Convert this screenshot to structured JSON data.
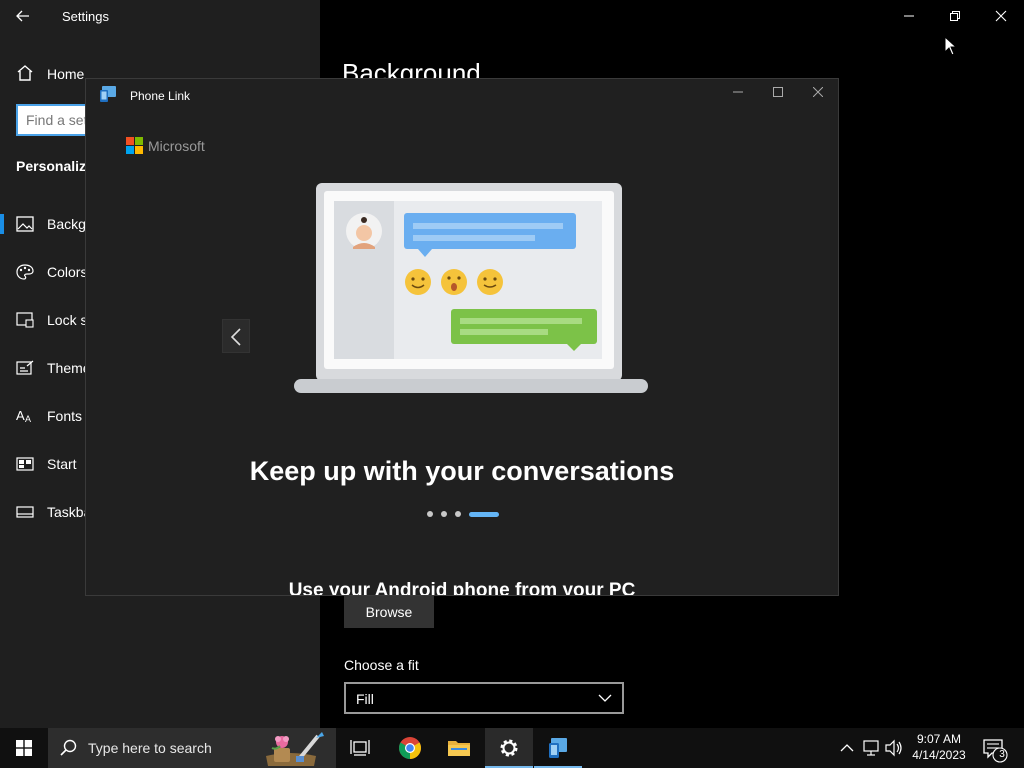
{
  "settings": {
    "title": "Settings",
    "home_label": "Home",
    "search_placeholder": "Find a setting",
    "section_title": "Personalization",
    "nav": [
      {
        "label": "Background",
        "icon": "picture-icon"
      },
      {
        "label": "Colors",
        "icon": "palette-icon"
      },
      {
        "label": "Lock screen",
        "icon": "lock-screen-icon"
      },
      {
        "label": "Themes",
        "icon": "themes-icon"
      },
      {
        "label": "Fonts",
        "icon": "fonts-icon"
      },
      {
        "label": "Start",
        "icon": "start-icon"
      },
      {
        "label": "Taskbar",
        "icon": "taskbar-icon"
      }
    ],
    "page_heading": "Background",
    "browse_label": "Browse",
    "fit_label": "Choose a fit",
    "fit_value": "Fill"
  },
  "phonelink": {
    "title": "Phone Link",
    "brand": "Microsoft",
    "headline": "Keep up with your conversations",
    "subheadline": "Use your Android phone from your PC",
    "carousel_pages": 4,
    "active_page": 4
  },
  "taskbar": {
    "search_placeholder": "Type here to search",
    "apps": [
      "task-view-icon",
      "chrome-icon",
      "file-explorer-icon",
      "settings-icon",
      "phone-link-icon"
    ],
    "time": "9:07 AM",
    "date": "4/14/2023",
    "notification_count": "3"
  },
  "colors": {
    "accent": "#1a8ee6",
    "carousel_active": "#64b5f6",
    "sidebar_bg": "#1f1f1f",
    "dialog_bg": "#202020"
  }
}
